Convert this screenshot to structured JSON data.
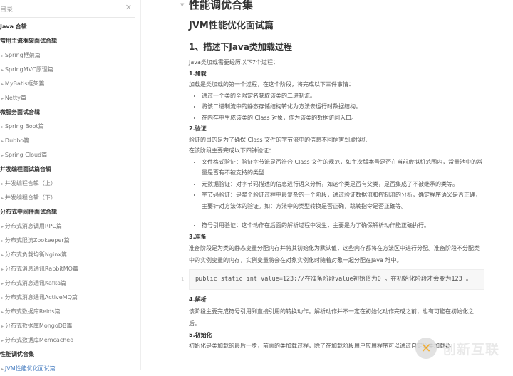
{
  "sidebar": {
    "title": "目录",
    "items": [
      {
        "label": "Java 合辑",
        "type": "h"
      },
      {
        "label": "常用主流框架面试合辑",
        "type": "h"
      },
      {
        "label": "Spring框架篇",
        "type": "c"
      },
      {
        "label": "SpringMVC原理篇",
        "type": "c"
      },
      {
        "label": "MyBatis框架篇",
        "type": "c"
      },
      {
        "label": "Netty篇",
        "type": "c"
      },
      {
        "label": "微服务面试合辑",
        "type": "h"
      },
      {
        "label": "Spring Boot篇",
        "type": "c"
      },
      {
        "label": "Dubbo篇",
        "type": "c"
      },
      {
        "label": "Spring Cloud篇",
        "type": "c"
      },
      {
        "label": "并发编程面试篇合辑",
        "type": "h"
      },
      {
        "label": "并发编程合辑（上）",
        "type": "c"
      },
      {
        "label": "并发编程合辑（下）",
        "type": "c"
      },
      {
        "label": "分布式中间件面试合辑",
        "type": "h"
      },
      {
        "label": "分布式消息调用RPC篇",
        "type": "c"
      },
      {
        "label": "分布式限流Zookeeper篇",
        "type": "c"
      },
      {
        "label": "分布式负载均衡Nginx篇",
        "type": "c"
      },
      {
        "label": "分布式消息通讯RabbitMQ篇",
        "type": "c"
      },
      {
        "label": "分布式消息通讯Kafka篇",
        "type": "c"
      },
      {
        "label": "分布式消息通讯ActiveMQ篇",
        "type": "c"
      },
      {
        "label": "分布式数据库Reids篇",
        "type": "c"
      },
      {
        "label": "分布式数据库MongoDB篇",
        "type": "c"
      },
      {
        "label": "分布式数据库Memcached",
        "type": "c"
      },
      {
        "label": "性能调优合集",
        "type": "h"
      },
      {
        "label": "JVM性能优化面试篇",
        "type": "c active"
      }
    ]
  },
  "doc": {
    "title": "性能调优合集",
    "subtitle": "JVM性能优化面试篇",
    "q1": "1、描述下Java类加载过程",
    "intro": "Java类加载需要经历以下7个过程：",
    "s1": {
      "title": "1.加载",
      "text": "加载是类加载的第一个过程，在这个阶段，将完成以下三件事情：",
      "bullets": [
        "通过一个类的全限定名获取该类的二进制流。",
        "将该二进制流中的静态存储结构转化为方法去运行时数据结构。",
        "在内存中生成该类的 Class 对象，作为该类的数据访问入口。"
      ]
    },
    "s2": {
      "title": "2.验证",
      "text1": "验证的目的是为了确保 Class 文件的字节流中的信息不回危害到虚拟机.",
      "text2": "在该阶段主要完成以下四钟验证：",
      "bullets": [
        "文件格式验证：验证字节流是否符合 Class 文件的规范，如主次版本号是否在当前虚拟机范围内，常量池中的常量是否有不被支持的类型.",
        "元数据验证：对字节码描述的信息进行语义分析，如这个类是否有父类，是否集成了不被继承的类等。",
        "字节码验证：是整个验证过程中最复杂的一个阶段，通过验证数据流和控制流的分析，确定程序语义是否正确，主要针对方法体的验证。如：方法中的类型转换是否正确，跳转指令是否正确等。",
        "符号引用验证：这个动作在后面的解析过程中发生，主要是为了确保解析动作能正确执行。"
      ]
    },
    "s3": {
      "title": "3.准备",
      "text": "准备阶段是为类的静态变量分配内存并将其初始化为默认值，这些内存都将在方法区中进行分配。准备阶段不分配类中的实例变量的内存，实例变量将会在对象实例化时随着对象一起分配在Java 堆中。",
      "code_line": "1",
      "code": "public static int value=123;//在准备阶段value初始值为0 。在初始化阶段才会变为123 。"
    },
    "s4": {
      "title": "4.解析",
      "text": "该阶段主要完成符号引用到直接引用的转换动作。解析动作并不一定在初始化动作完成之前，也有可能在初始化之后。"
    },
    "s5": {
      "title": "5.初始化",
      "text": "初始化是类加载的最后一步，前面的类加载过程，除了在加载阶段用户应用程序可以通过自定义类加载器"
    }
  },
  "watermark": {
    "text": "创新互联"
  }
}
